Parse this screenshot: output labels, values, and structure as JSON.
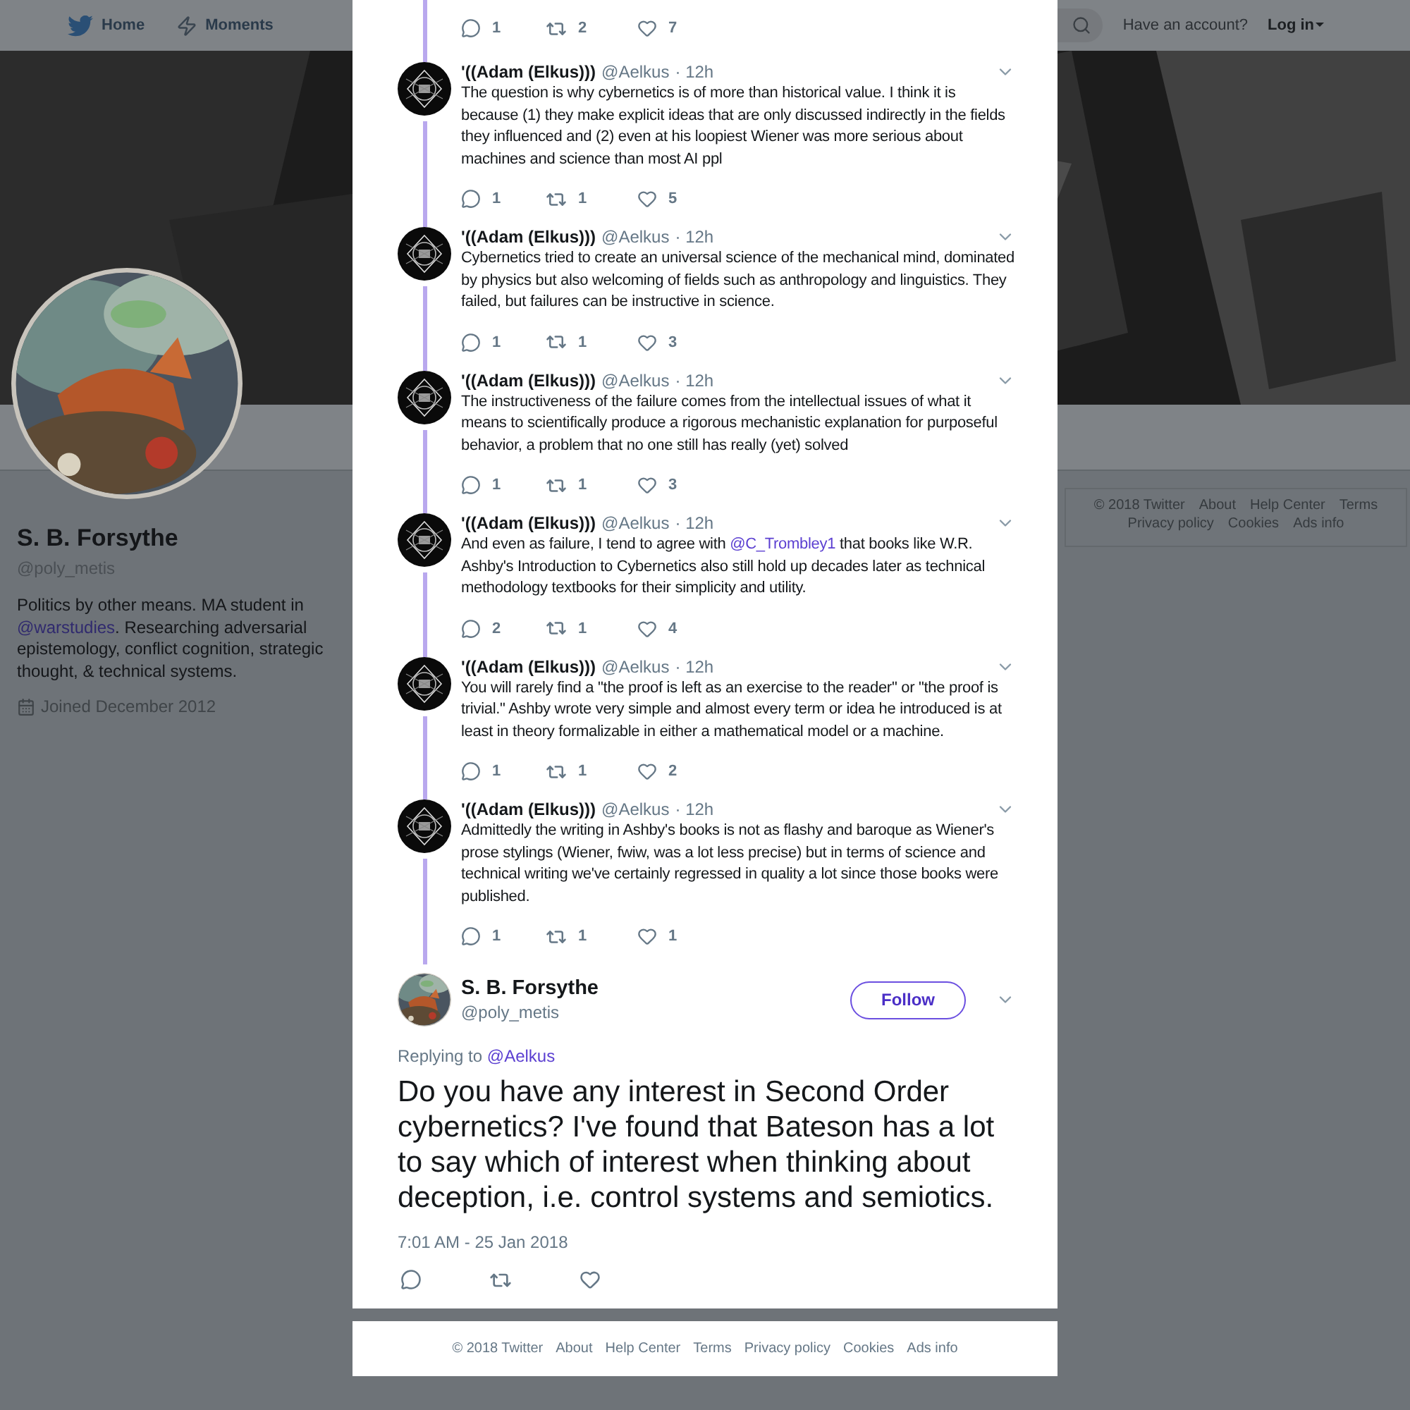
{
  "nav": {
    "items": [
      {
        "label": "Home",
        "kind": "home"
      },
      {
        "label": "Moments",
        "kind": "moments"
      }
    ],
    "account_prompt": "Have an account?",
    "login": "Log in"
  },
  "profile": {
    "name": "S. B. Forsythe",
    "handle": "@poly_metis",
    "bio": [
      {
        "kind": "text",
        "text": "Politics by other means. MA student in "
      },
      {
        "kind": "link",
        "text": "@warstudies"
      },
      {
        "kind": "text",
        "text": ". Researching adversarial epistemology, conflict cognition, strategic thought, & technical systems."
      }
    ],
    "joined": "Joined December 2012"
  },
  "side_footer": [
    "© 2018 Twitter",
    "About",
    "Help Center",
    "Terms",
    "Privacy policy",
    "Cookies",
    "Ads info"
  ],
  "thread": [
    {
      "kind": "partial",
      "replies": "1",
      "retweets": "2",
      "likes": "7"
    },
    {
      "kind": "tweet",
      "name": "'((Adam (Elkus)))",
      "handle": "@Aelkus",
      "time": "· 12h",
      "text": [
        {
          "kind": "text",
          "text": "The question is why cybernetics is of more than historical value. I think it is because (1) they make explicit ideas that are only discussed indirectly in the fields they influenced and (2) even at his loopiest Wiener was more serious about machines and science than most AI ppl"
        }
      ],
      "replies": "1",
      "retweets": "1",
      "likes": "5"
    },
    {
      "kind": "tweet",
      "name": "'((Adam (Elkus)))",
      "handle": "@Aelkus",
      "time": "· 12h",
      "text": [
        {
          "kind": "text",
          "text": "Cybernetics tried to create an universal science of the mechanical mind, dominated by physics but also welcoming of fields such as anthropology and linguistics. They failed, but failures can be instructive in science."
        }
      ],
      "replies": "1",
      "retweets": "1",
      "likes": "3"
    },
    {
      "kind": "tweet",
      "name": "'((Adam (Elkus)))",
      "handle": "@Aelkus",
      "time": "· 12h",
      "text": [
        {
          "kind": "text",
          "text": "The instructiveness of the failure comes from the intellectual issues of what it means to scientifically produce a rigorous mechanistic explanation for purposeful behavior, a problem that no one still has really (yet) solved"
        }
      ],
      "replies": "1",
      "retweets": "1",
      "likes": "3"
    },
    {
      "kind": "tweet",
      "name": "'((Adam (Elkus)))",
      "handle": "@Aelkus",
      "time": "· 12h",
      "text": [
        {
          "kind": "text",
          "text": "And even as failure, I tend to agree with "
        },
        {
          "kind": "link",
          "text": "@C_Trombley1"
        },
        {
          "kind": "text",
          "text": " that books like W.R. Ashby's Introduction to Cybernetics also still hold up decades later as technical methodology textbooks for their simplicity and utility."
        }
      ],
      "replies": "2",
      "retweets": "1",
      "likes": "4"
    },
    {
      "kind": "tweet",
      "name": "'((Adam (Elkus)))",
      "handle": "@Aelkus",
      "time": "· 12h",
      "text": [
        {
          "kind": "text",
          "text": "You will rarely find a \"the proof is left as an exercise to the reader\" or \"the proof is trivial.\" Ashby wrote very simple and almost every term or idea he introduced is at least in theory formalizable in either a mathematical model or a machine."
        }
      ],
      "replies": "1",
      "retweets": "1",
      "likes": "2"
    },
    {
      "kind": "tweet",
      "name": "'((Adam (Elkus)))",
      "handle": "@Aelkus",
      "time": "· 12h",
      "text": [
        {
          "kind": "text",
          "text": "Admittedly the writing in Ashby's books is not as flashy and baroque as Wiener's prose stylings (Wiener, fwiw, was a lot less precise) but in terms of science and technical writing we've certainly regressed in quality a lot since those books were published."
        }
      ],
      "replies": "1",
      "retweets": "1",
      "likes": "1"
    }
  ],
  "main_tweet": {
    "name": "S. B. Forsythe",
    "handle": "@poly_metis",
    "follow": "Follow",
    "replying_prefix": "Replying to",
    "replying_to": "@Aelkus",
    "text": "Do you have any interest in Second Order cybernetics? I've found that Bateson has a lot to say which of interest when thinking about deception, i.e. control systems and semiotics.",
    "timestamp": "7:01 AM - 25 Jan 2018"
  },
  "modal_footer": [
    "© 2018 Twitter",
    "About",
    "Help Center",
    "Terms",
    "Privacy policy",
    "Cookies",
    "Ads info"
  ]
}
